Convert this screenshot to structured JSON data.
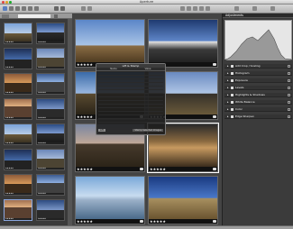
{
  "window": {
    "title": "Aperture"
  },
  "library": {
    "search_placeholder": ""
  },
  "thumbnails": [
    {
      "stars": "★★★★★"
    },
    {
      "stars": "★★★★★"
    },
    {
      "stars": "★★★★★"
    },
    {
      "stars": "★★★★★"
    },
    {
      "stars": "★★★★★"
    },
    {
      "stars": "★★★★★"
    },
    {
      "stars": "★★★★★"
    },
    {
      "stars": "★★★★★"
    },
    {
      "stars": "★★★★★"
    },
    {
      "stars": "★★★★★"
    },
    {
      "stars": "★★★★★"
    },
    {
      "stars": "★★★★★"
    },
    {
      "stars": "★★★★★"
    },
    {
      "stars": "★★★★★"
    },
    {
      "stars": "★★★★★"
    },
    {
      "stars": "★★★★★"
    }
  ],
  "photos": [
    {
      "stars": "★★★★★"
    },
    {
      "stars": "★★★★★"
    },
    {
      "stars": "★★★★★"
    },
    {
      "stars": "★★★★★"
    },
    {
      "stars": "★★★★★"
    },
    {
      "stars": "★★★★★"
    },
    {
      "stars": "★★★★★"
    },
    {
      "stars": "★★★★★"
    }
  ],
  "hud": {
    "title": "Lift & Stamp",
    "col1": "Name",
    "col2": "Value",
    "button": "Lift",
    "action": "Stamp Selected Images"
  },
  "adjustments": {
    "title": "Adjustments",
    "sections": [
      "Add Crop / Scaling",
      "Histogram",
      "Exposure",
      "Levels",
      "Highlights & Shadows",
      "White Balance",
      "Color",
      "Edge Sharpen"
    ]
  },
  "colors": {
    "accent": "#8aa7e0",
    "hud_bg": "#1e1e1e"
  }
}
